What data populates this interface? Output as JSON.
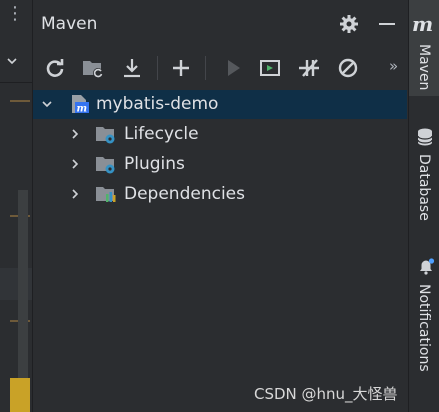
{
  "panel": {
    "title": "Maven",
    "toolbar": {
      "more": "»",
      "icons": [
        "reload-icon",
        "folder-sync-icon",
        "download-icon",
        "add-icon",
        "run-icon",
        "execute-goal-icon",
        "toggle-offline-icon",
        "skip-tests-icon"
      ]
    },
    "tree": [
      {
        "label": "mybatis-demo",
        "icon": "maven-project-icon",
        "expanded": true,
        "selected": true
      },
      {
        "label": "Lifecycle",
        "icon": "lifecycle-folder-icon",
        "expanded": false
      },
      {
        "label": "Plugins",
        "icon": "plugins-folder-icon",
        "expanded": false
      },
      {
        "label": "Dependencies",
        "icon": "dependencies-folder-icon",
        "expanded": false
      }
    ]
  },
  "right_bar": {
    "maven_tab": "Maven",
    "database_tab": "Database",
    "notifications_tab": "Notifications"
  },
  "watermark": "CSDN @hnu_大怪兽",
  "colors": {
    "background": "#2b2d30",
    "selection": "#0f2f47",
    "folder": "#8a8f96",
    "gear_badge": "#3592c4",
    "notification_dot": "#4fa0ff"
  }
}
